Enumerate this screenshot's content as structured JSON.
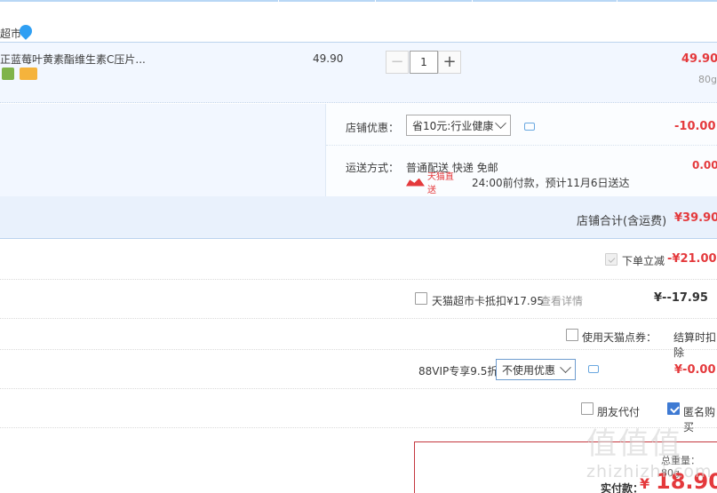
{
  "seller": {
    "name_fragment": "超市"
  },
  "item": {
    "title": "正蓝莓叶黄素酯维生素C压片...",
    "unit_price": "49.90",
    "quantity": "1",
    "minus": "−",
    "plus": "+",
    "subtotal": "49.90",
    "weight": "80g"
  },
  "shop": {
    "discount_label": "店铺优惠：",
    "discount_value": "省10元:行业健康",
    "discount_amount": "-10.00",
    "shipping_label": "运送方式：",
    "shipping_text": "普通配送 快递 免邮",
    "shipping_amount": "0.00",
    "tmall_badge": "天猫直送",
    "delivery_text": "24:00前付款，预计11月6日送达"
  },
  "totals": {
    "shop_total_label": "店铺合计(含运费)",
    "shop_total_value": "¥39.90",
    "instant_label": "下单立减",
    "instant_value": "-¥21.00",
    "card_label": "天猫超市卡抵扣¥17.95",
    "card_link": "查看详情",
    "card_value": "¥--17.95",
    "points_label": "使用天猫点券：",
    "points_right": "结算时扣除",
    "vip_label": "88VIP专享9.5折",
    "vip_select": "不使用优惠",
    "vip_value": "¥-0.00",
    "friend_pay": "朋友代付",
    "anonymous": "匿名购买",
    "weight_label": "总重量：80g",
    "pay_label": "实付款：",
    "pay_currency": "¥",
    "pay_value": "18.90"
  },
  "watermark": {
    "top": "值值值",
    "bottom": "zhizhizhi.com"
  },
  "colors": {
    "price_red": "#e4393c",
    "accent_blue": "#3e7ad3",
    "row_blue": "#f2f7ff"
  }
}
